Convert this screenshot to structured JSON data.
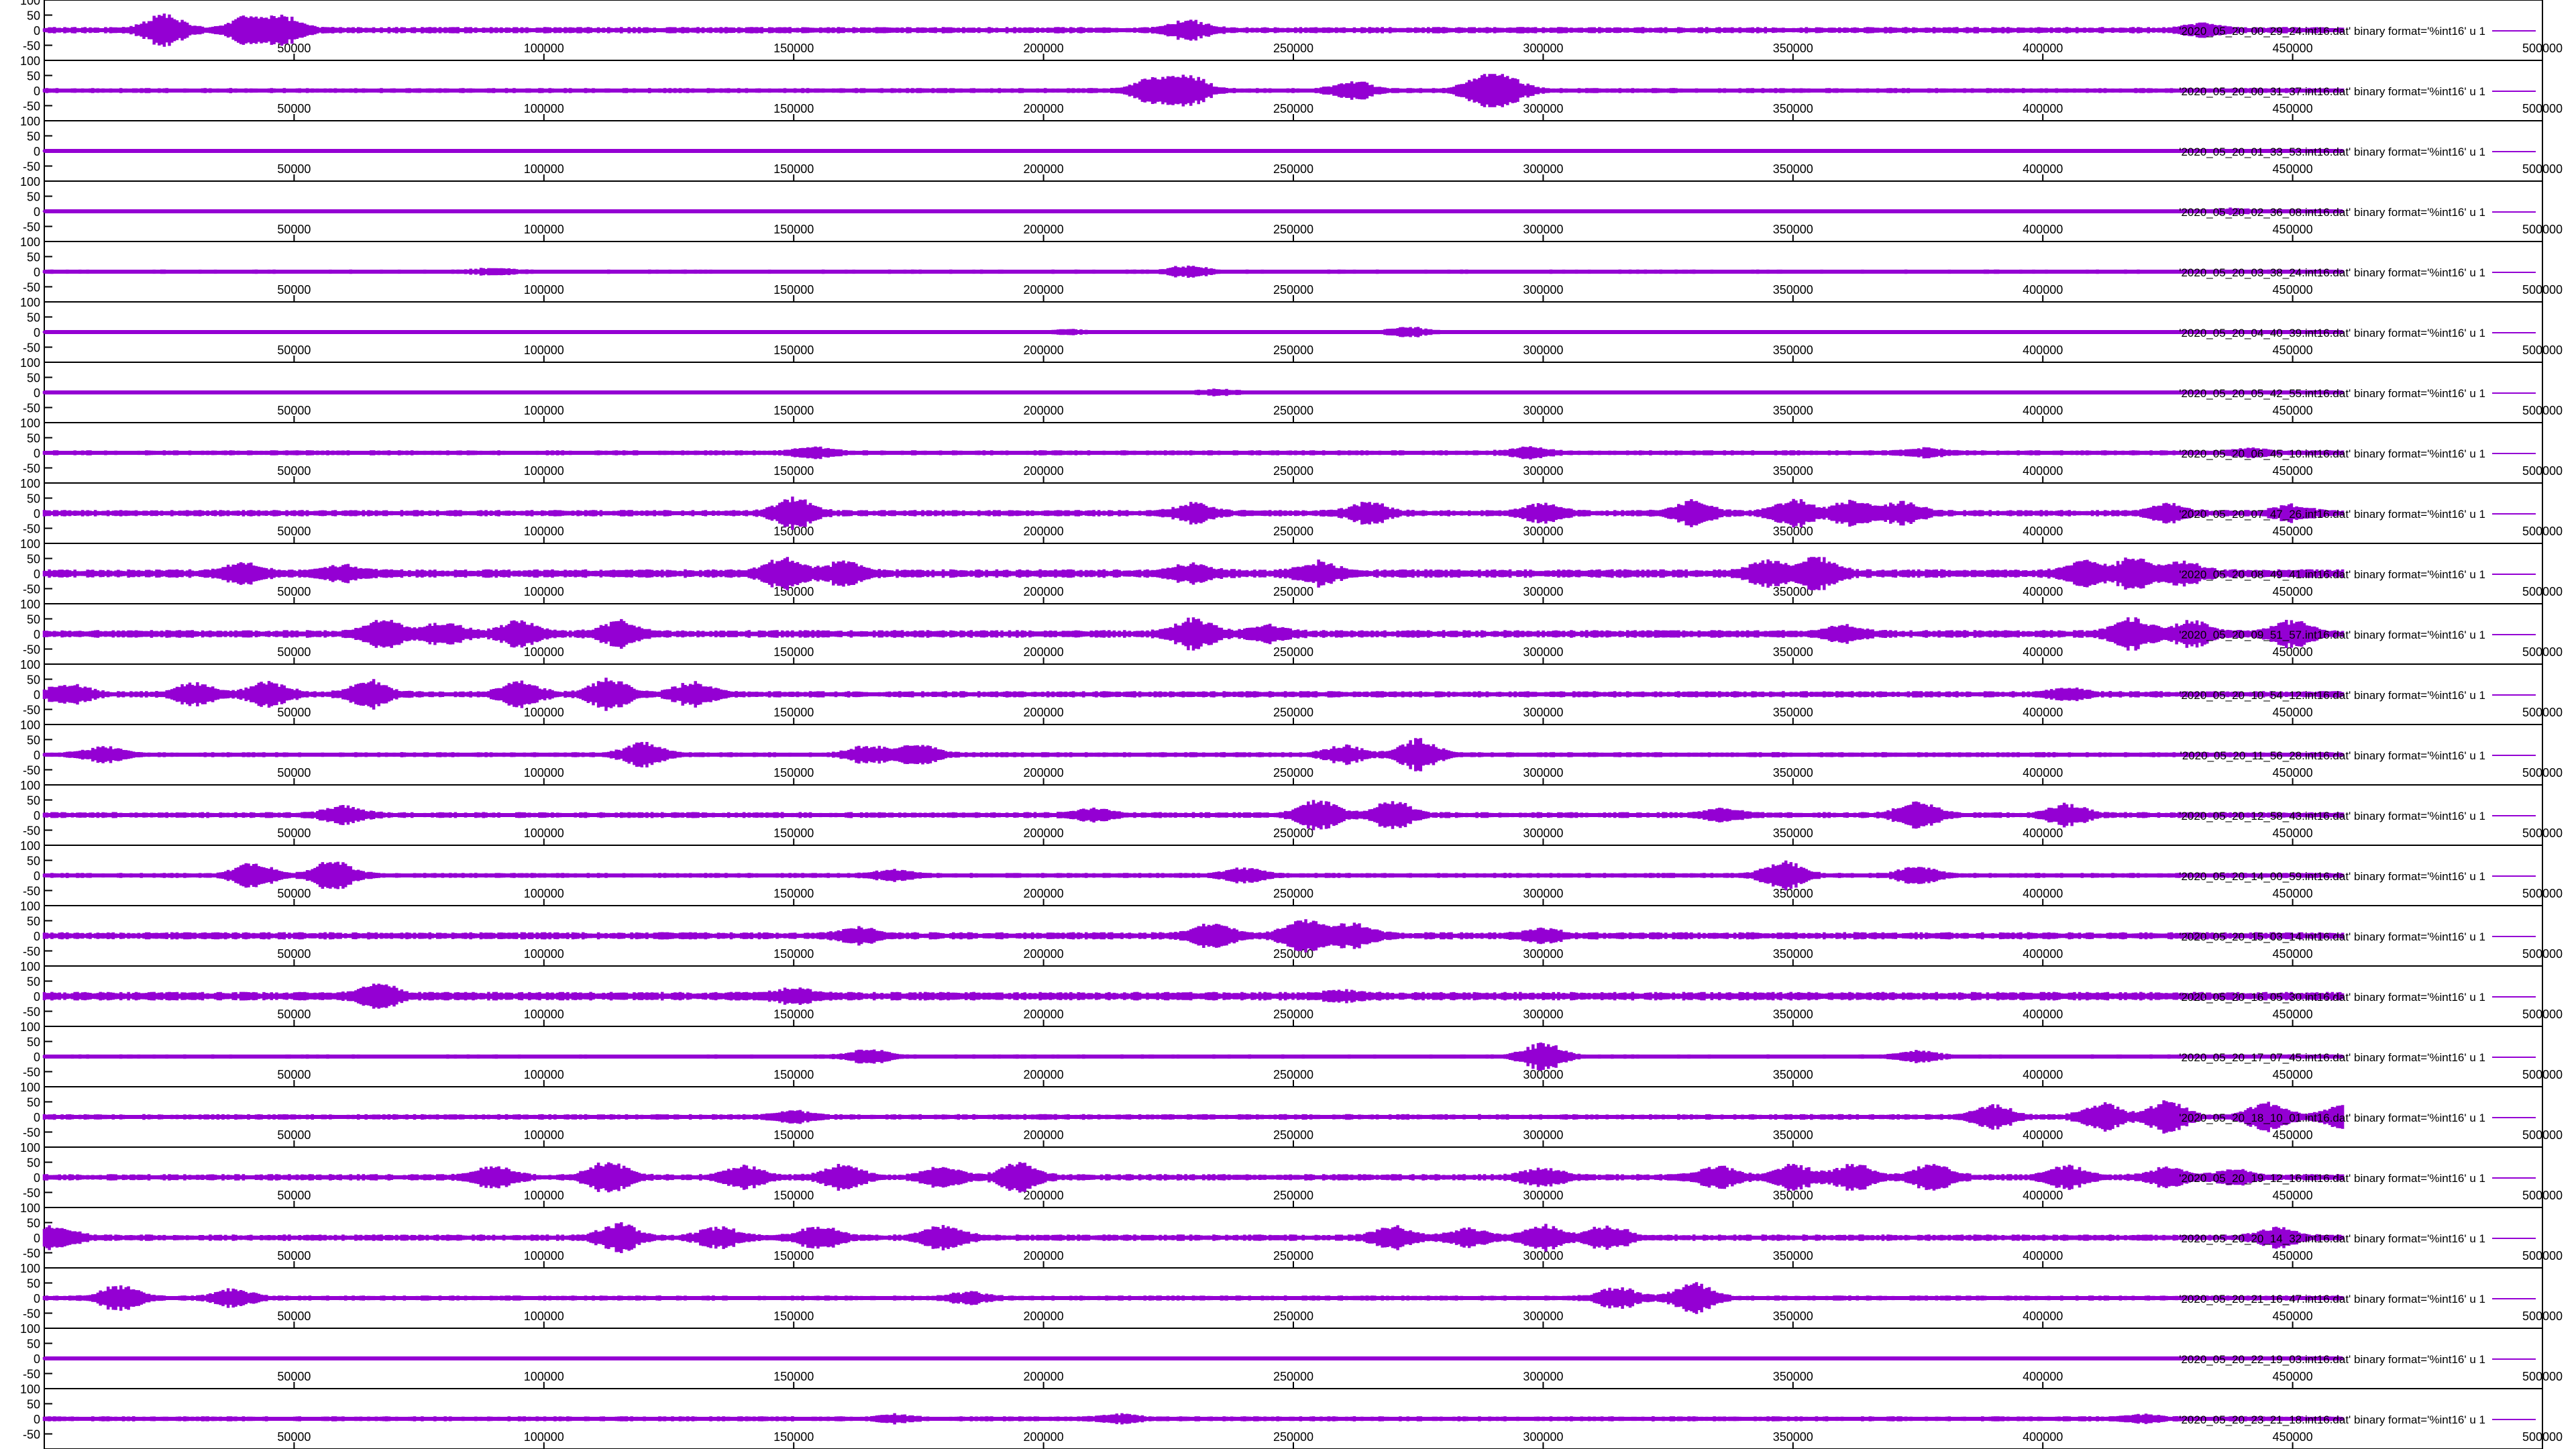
{
  "colors": {
    "trace": "#9400d3",
    "axis": "#000000",
    "background": "#ffffff"
  },
  "chart_data": {
    "type": "line",
    "layout": "stacked panels",
    "xlim": [
      0,
      500000
    ],
    "ylim": [
      -100,
      100
    ],
    "x_ticks": [
      "50000",
      "100000",
      "150000",
      "200000",
      "250000",
      "300000",
      "350000",
      "400000",
      "450000",
      "500000"
    ],
    "y_ticks": [
      "-50",
      "0",
      "50",
      "100"
    ],
    "x_tick_values": [
      50000,
      100000,
      150000,
      200000,
      250000,
      300000,
      350000,
      400000,
      450000,
      500000
    ],
    "y_tick_values": [
      -50,
      0,
      50,
      100
    ],
    "grid": false,
    "legend_position": "right",
    "points_per_series": 460000,
    "series": [
      {
        "name": "'2020_05_20_00_29_24.int16.dat' binary format='%int16' u 1",
        "bursts": [
          [
            24000,
            0.95
          ],
          [
            41000,
            0.8
          ],
          [
            48000,
            0.7
          ],
          [
            229000,
            0.5
          ],
          [
            432000,
            0.35
          ]
        ]
      },
      {
        "name": "'2020_05_20_00_31_37.int16.dat' binary format='%int16' u 1",
        "bursts": [
          [
            222000,
            0.8
          ],
          [
            229000,
            0.9
          ],
          [
            262000,
            0.5
          ],
          [
            288000,
            0.85
          ],
          [
            293000,
            0.6
          ]
        ]
      },
      {
        "name": "'2020_05_20_01_33_53.int16.dat' binary format='%int16' u 1",
        "bursts": []
      },
      {
        "name": "'2020_05_20_02_36_08.int16.dat' binary format='%int16' u 1",
        "bursts": [
          [
            438000,
            0.15
          ]
        ]
      },
      {
        "name": "'2020_05_20_03_38_24.int16.dat' binary format='%int16' u 1",
        "bursts": [
          [
            90000,
            0.15
          ],
          [
            229000,
            0.3
          ]
        ]
      },
      {
        "name": "'2020_05_20_04_40_39.int16.dat' binary format='%int16' u 1",
        "bursts": [
          [
            205000,
            0.15
          ],
          [
            273000,
            0.3
          ]
        ]
      },
      {
        "name": "'2020_05_20_05_42_55.int16.dat' binary format='%int16' u 1",
        "bursts": [
          [
            235000,
            0.15
          ]
        ]
      },
      {
        "name": "'2020_05_20_06_45_10.int16.dat' binary format='%int16' u 1",
        "bursts": [
          [
            154000,
            0.3
          ],
          [
            297000,
            0.3
          ],
          [
            377000,
            0.2
          ],
          [
            442000,
            0.2
          ]
        ]
      },
      {
        "name": "'2020_05_20_07_47_26.int16.dat' binary format='%int16' u 1",
        "bursts": [
          [
            150000,
            0.9
          ],
          [
            230000,
            0.5
          ],
          [
            265000,
            0.6
          ],
          [
            300000,
            0.5
          ],
          [
            330000,
            0.7
          ],
          [
            350000,
            0.8
          ],
          [
            362000,
            0.7
          ],
          [
            372000,
            0.6
          ],
          [
            425000,
            0.5
          ],
          [
            450000,
            0.4
          ]
        ]
      },
      {
        "name": "'2020_05_20_08_49_41.int16.dat' binary format='%int16' u 1",
        "bursts": [
          [
            40000,
            0.5
          ],
          [
            60000,
            0.4
          ],
          [
            148000,
            0.9
          ],
          [
            160000,
            0.6
          ],
          [
            230000,
            0.5
          ],
          [
            255000,
            0.6
          ],
          [
            345000,
            0.7
          ],
          [
            355000,
            0.9
          ],
          [
            408000,
            0.6
          ],
          [
            418000,
            0.8
          ],
          [
            428000,
            0.6
          ]
        ]
      },
      {
        "name": "'2020_05_20_09_51_57.int16.dat' binary format='%int16' u 1",
        "bursts": [
          [
            68000,
            0.8
          ],
          [
            80000,
            0.6
          ],
          [
            95000,
            0.7
          ],
          [
            115000,
            0.7
          ],
          [
            230000,
            0.9
          ],
          [
            245000,
            0.4
          ],
          [
            360000,
            0.4
          ],
          [
            418000,
            0.9
          ],
          [
            430000,
            0.7
          ],
          [
            450000,
            0.7
          ]
        ]
      },
      {
        "name": "'2020_05_20_10_54_12.int16.dat' binary format='%int16' u 1",
        "bursts": [
          [
            5000,
            0.6
          ],
          [
            30000,
            0.6
          ],
          [
            45000,
            0.7
          ],
          [
            65000,
            0.8
          ],
          [
            95000,
            0.8
          ],
          [
            113000,
            0.9
          ],
          [
            130000,
            0.7
          ],
          [
            405000,
            0.3
          ]
        ]
      },
      {
        "name": "'2020_05_20_11_56_28.int16.dat' binary format='%int16' u 1",
        "bursts": [
          [
            12000,
            0.4
          ],
          [
            120000,
            0.7
          ],
          [
            165000,
            0.5
          ],
          [
            175000,
            0.6
          ],
          [
            260000,
            0.5
          ],
          [
            275000,
            0.9
          ]
        ]
      },
      {
        "name": "'2020_05_20_12_58_43.int16.dat' binary format='%int16' u 1",
        "bursts": [
          [
            60000,
            0.5
          ],
          [
            210000,
            0.3
          ],
          [
            255000,
            0.9
          ],
          [
            270000,
            0.8
          ],
          [
            336000,
            0.3
          ],
          [
            375000,
            0.8
          ],
          [
            405000,
            0.6
          ]
        ]
      },
      {
        "name": "'2020_05_20_14_00_59.int16.dat' binary format='%int16' u 1",
        "bursts": [
          [
            42000,
            0.7
          ],
          [
            58000,
            0.9
          ],
          [
            170000,
            0.3
          ],
          [
            240000,
            0.4
          ],
          [
            348000,
            0.9
          ],
          [
            375000,
            0.5
          ]
        ]
      },
      {
        "name": "'2020_05_20_15_03_14.int16.dat' binary format='%int16' u 1",
        "bursts": [
          [
            163000,
            0.4
          ],
          [
            234000,
            0.7
          ],
          [
            252000,
            0.9
          ],
          [
            262000,
            0.7
          ],
          [
            300000,
            0.3
          ]
        ]
      },
      {
        "name": "'2020_05_20_16_05_30.int16.dat' binary format='%int16' u 1",
        "bursts": [
          [
            67000,
            0.6
          ],
          [
            150000,
            0.35
          ],
          [
            260000,
            0.2
          ]
        ]
      },
      {
        "name": "'2020_05_20_17_07_45.int16.dat' binary format='%int16' u 1",
        "bursts": [
          [
            165000,
            0.4
          ],
          [
            300000,
            0.8
          ],
          [
            375000,
            0.3
          ]
        ]
      },
      {
        "name": "'2020_05_20_18_10_01.int16.dat' binary format='%int16' u 1",
        "bursts": [
          [
            150000,
            0.3
          ],
          [
            390000,
            0.7
          ],
          [
            412000,
            0.8
          ],
          [
            425000,
            0.9
          ],
          [
            445000,
            0.9
          ],
          [
            460000,
            0.7
          ]
        ]
      },
      {
        "name": "'2020_05_20_19_12_16.int16.dat' binary format='%int16' u 1",
        "bursts": [
          [
            90000,
            0.6
          ],
          [
            113000,
            0.9
          ],
          [
            140000,
            0.6
          ],
          [
            160000,
            0.7
          ],
          [
            180000,
            0.6
          ],
          [
            195000,
            0.8
          ],
          [
            300000,
            0.5
          ],
          [
            335000,
            0.6
          ],
          [
            350000,
            0.7
          ],
          [
            362000,
            0.8
          ],
          [
            378000,
            0.7
          ],
          [
            405000,
            0.6
          ],
          [
            425000,
            0.5
          ],
          [
            438000,
            0.4
          ]
        ]
      },
      {
        "name": "'2020_05_20_20_14_32.int16.dat' binary format='%int16' u 1",
        "bursts": [
          [
            2000,
            0.7
          ],
          [
            115000,
            0.8
          ],
          [
            135000,
            0.6
          ],
          [
            155000,
            0.7
          ],
          [
            180000,
            0.7
          ],
          [
            270000,
            0.6
          ],
          [
            285000,
            0.5
          ],
          [
            300000,
            0.7
          ],
          [
            313000,
            0.7
          ],
          [
            447000,
            0.5
          ]
        ]
      },
      {
        "name": "'2020_05_20_21_16_47.int16.dat' binary format='%int16' u 1",
        "bursts": [
          [
            15000,
            0.7
          ],
          [
            38000,
            0.5
          ],
          [
            185000,
            0.3
          ],
          [
            315000,
            0.6
          ],
          [
            330000,
            0.9
          ]
        ]
      },
      {
        "name": "'2020_05_20_22_19_03.int16.dat' binary format='%int16' u 1",
        "bursts": []
      },
      {
        "name": "'2020_05_20_23_21_18.int16.dat' binary format='%int16' u 1",
        "bursts": [
          [
            170000,
            0.2
          ],
          [
            215000,
            0.2
          ],
          [
            420000,
            0.2
          ]
        ]
      }
    ],
    "steady_noise": [
      0.15,
      0.12,
      0.08,
      0.07,
      0.1,
      0.07,
      0.08,
      0.12,
      0.15,
      0.2,
      0.18,
      0.15,
      0.12,
      0.14,
      0.12,
      0.17,
      0.2,
      0.1,
      0.13,
      0.15,
      0.15,
      0.12,
      0.07,
      0.12
    ]
  }
}
